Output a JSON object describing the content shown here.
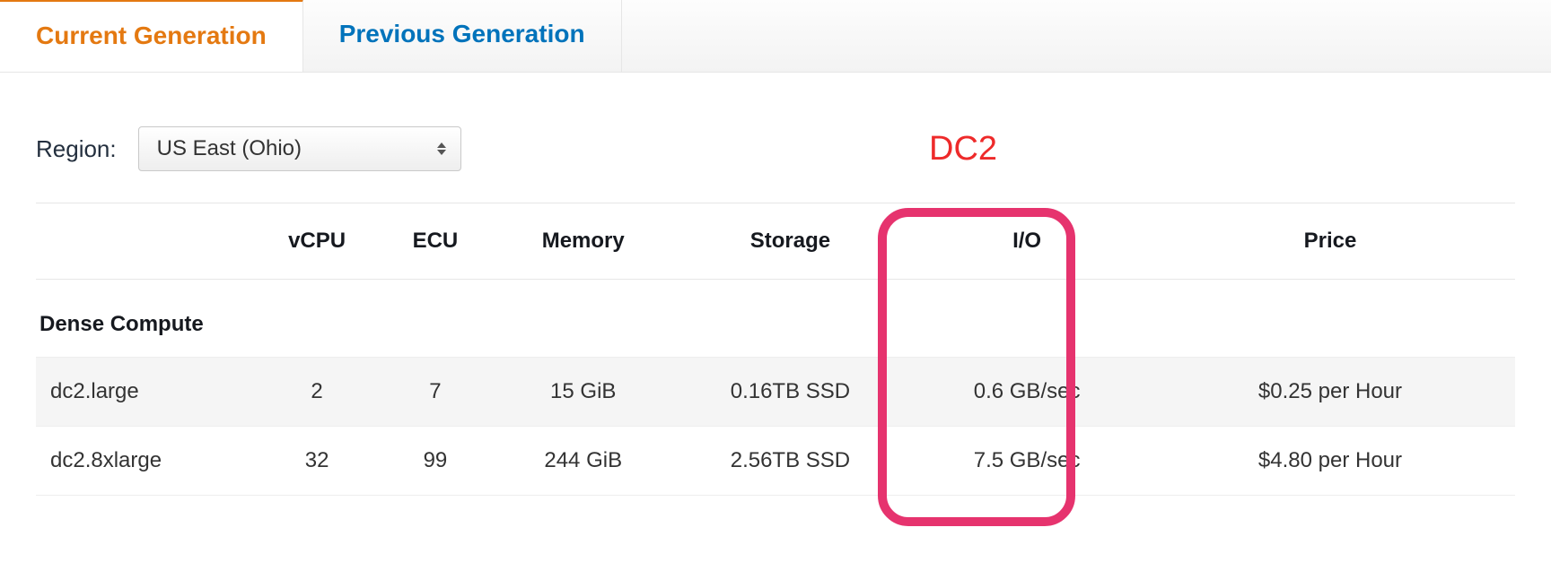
{
  "tabs": {
    "current": "Current Generation",
    "previous": "Previous Generation"
  },
  "region": {
    "label": "Region:",
    "selected": "US East (Ohio)"
  },
  "columns": {
    "name": "",
    "vcpu": "vCPU",
    "ecu": "ECU",
    "memory": "Memory",
    "storage": "Storage",
    "io": "I/O",
    "price": "Price"
  },
  "section": "Dense Compute",
  "rows": [
    {
      "name": "dc2.large",
      "vcpu": "2",
      "ecu": "7",
      "memory": "15 GiB",
      "storage": "0.16TB SSD",
      "io": "0.6 GB/sec",
      "price": "$0.25 per Hour"
    },
    {
      "name": "dc2.8xlarge",
      "vcpu": "32",
      "ecu": "99",
      "memory": "244 GiB",
      "storage": "2.56TB SSD",
      "io": "7.5 GB/sec",
      "price": "$4.80 per Hour"
    }
  ],
  "annotation": {
    "label": "DC2"
  }
}
